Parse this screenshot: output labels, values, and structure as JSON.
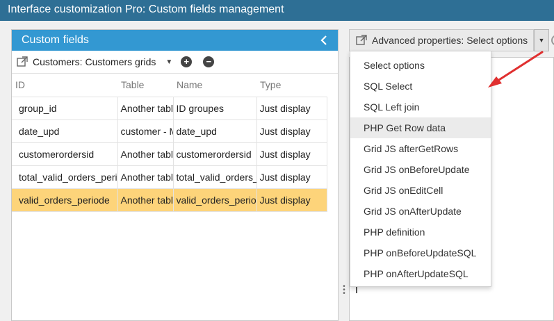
{
  "window": {
    "title": "Interface customization Pro: Custom fields management"
  },
  "left_panel": {
    "title": "Custom fields",
    "toolbar": {
      "grid_selector": "Customers: Customers grids"
    },
    "table": {
      "columns": [
        "ID",
        "Table",
        "Name",
        "Type"
      ],
      "rows": [
        [
          "group_id",
          "Another table",
          "ID groupes",
          "Just display"
        ],
        [
          "date_upd",
          "customer - M",
          "date_upd",
          "Just display"
        ],
        [
          "customerordersid",
          "Another table",
          "customerordersid",
          "Just display"
        ],
        [
          "total_valid_orders_periode",
          "Another table",
          "total_valid_orders_periode",
          "Just display"
        ],
        [
          "valid_orders_periode",
          "Another table",
          "valid_orders_periode",
          "Just display"
        ]
      ],
      "selected_row": 4
    }
  },
  "right_panel": {
    "advanced_properties_label": "Advanced properties: Select options",
    "dropdown": {
      "items": [
        "Select options",
        "SQL Select",
        "SQL Left join",
        "PHP Get Row data",
        "Grid JS afterGetRows",
        "Grid JS onBeforeUpdate",
        "Grid JS onEditCell",
        "Grid JS onAfterUpdate",
        "PHP definition",
        "PHP onBeforeUpdateSQL",
        "PHP onAfterUpdateSQL"
      ],
      "hovered_item": 3
    }
  },
  "colors": {
    "titlebar": "#2e6f95",
    "panel_header": "#3398d2",
    "selected_row": "#fdd47a",
    "annotation_arrow": "#e03030"
  },
  "icons": {
    "collapse": "chevron-left-icon",
    "external": "external-link-icon",
    "add": "plus-circle-icon",
    "remove": "minus-circle-icon",
    "dropdown": "caret-down-icon"
  }
}
